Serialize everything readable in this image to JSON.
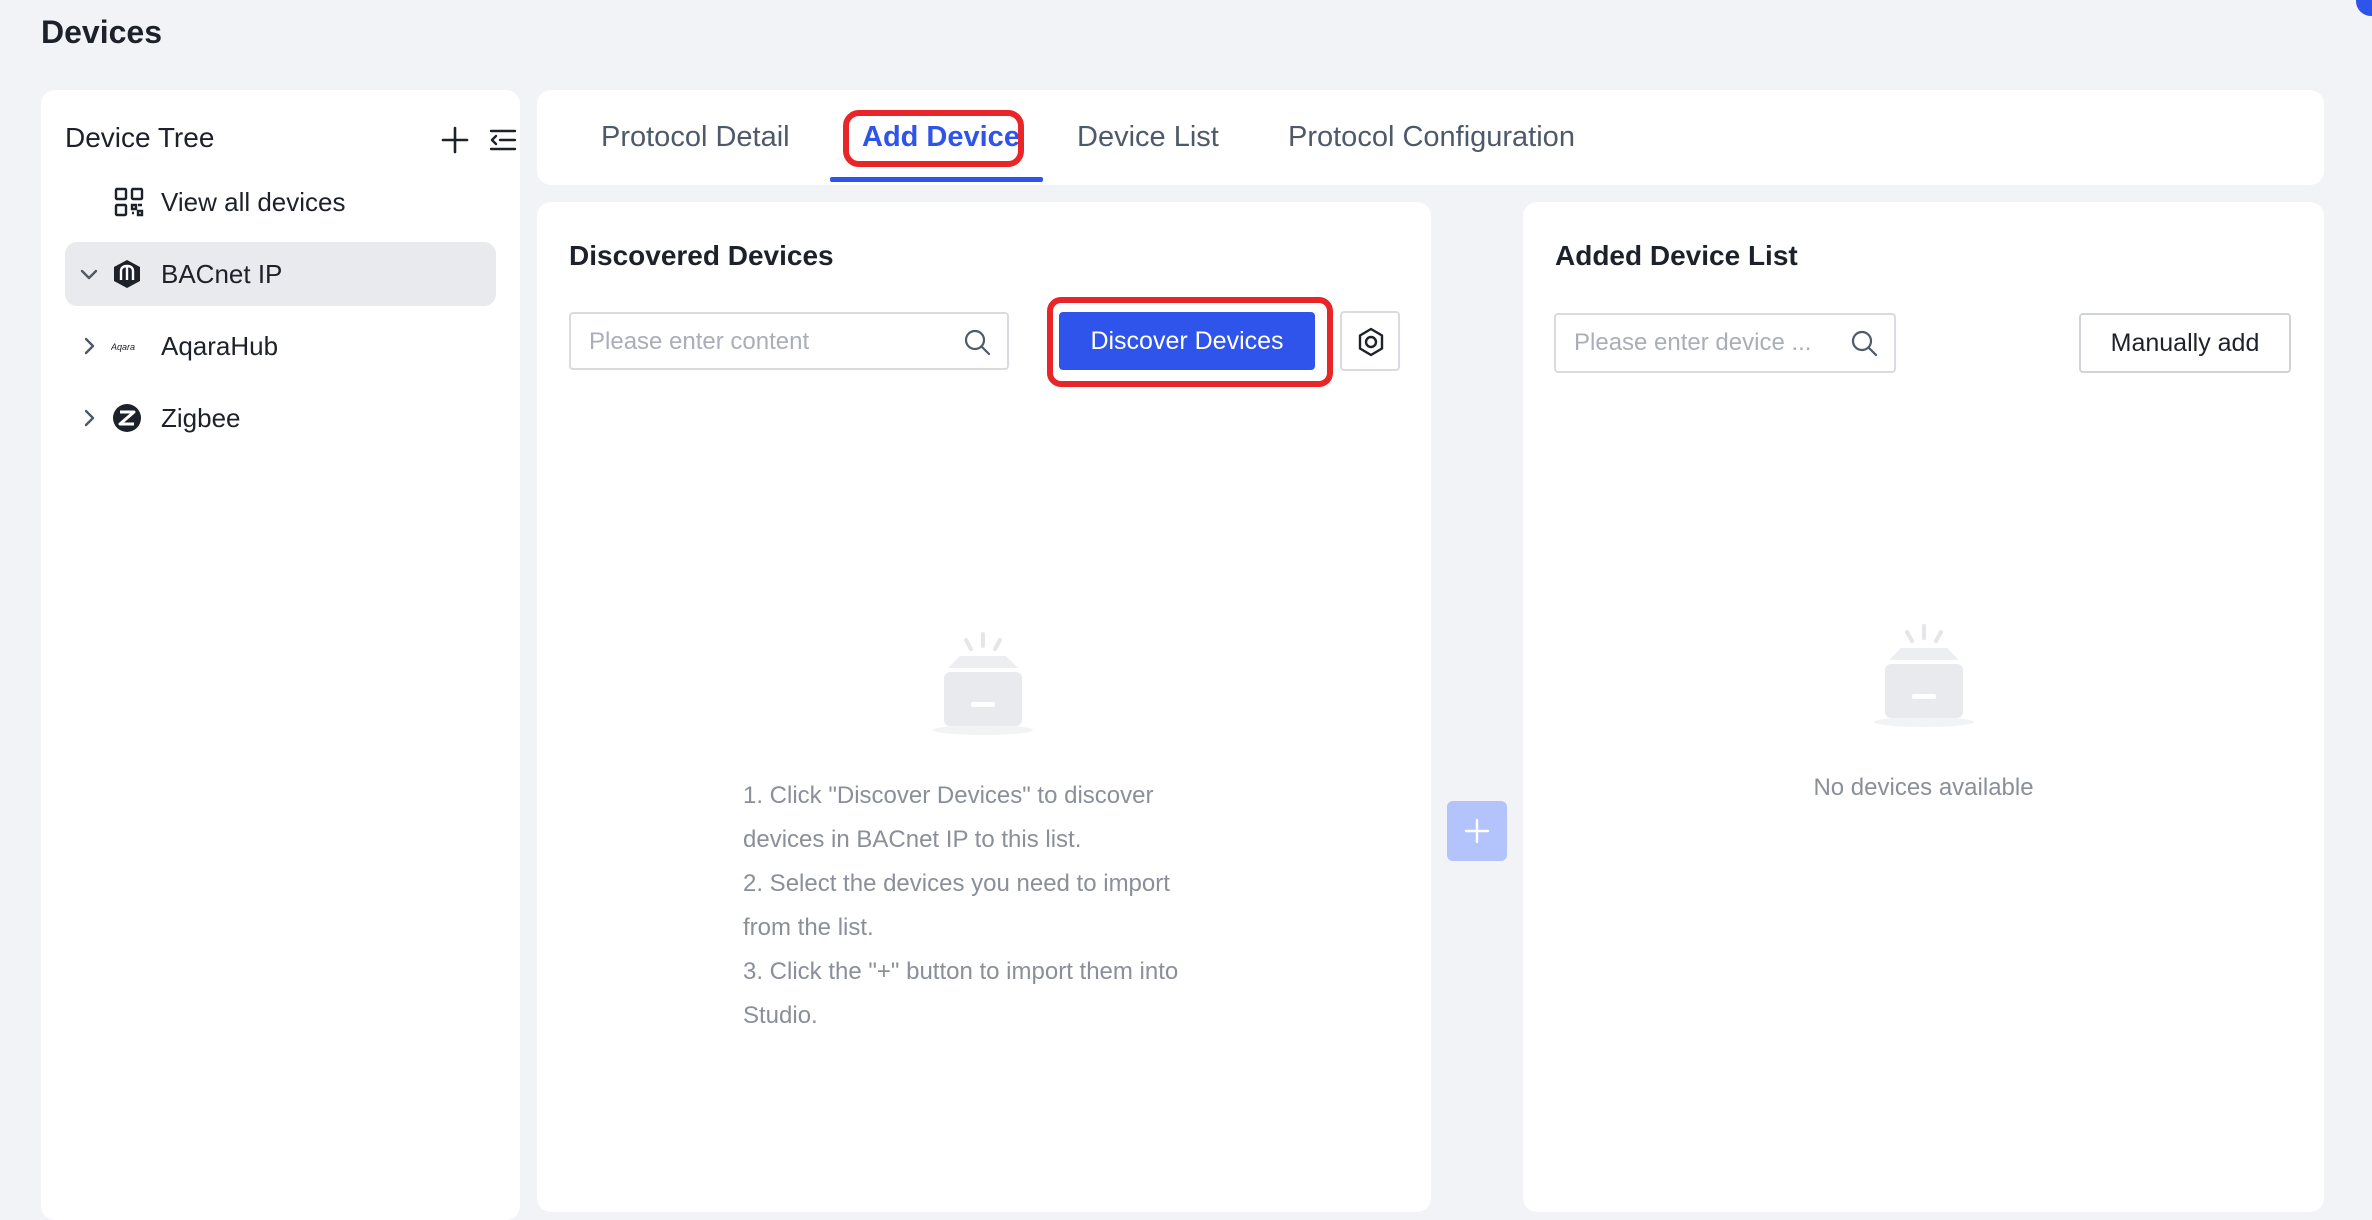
{
  "page": {
    "title": "Devices"
  },
  "sidebar": {
    "title": "Device Tree",
    "view_all": "View all devices",
    "items": [
      {
        "label": "BACnet IP",
        "icon": "bacnet-icon",
        "expanded": true,
        "selected": true
      },
      {
        "label": "AqaraHub",
        "icon": "aqara-logo-icon",
        "expanded": false,
        "selected": false
      },
      {
        "label": "Zigbee",
        "icon": "zigbee-icon",
        "expanded": false,
        "selected": false
      }
    ],
    "aqara_logo_text": "Aqara"
  },
  "tabs": [
    {
      "label": "Protocol Detail",
      "active": false
    },
    {
      "label": "Add Device",
      "active": true
    },
    {
      "label": "Device List",
      "active": false
    },
    {
      "label": "Protocol Configuration",
      "active": false
    }
  ],
  "discovered": {
    "title": "Discovered Devices",
    "search_placeholder": "Please enter content",
    "discover_button": "Discover Devices",
    "instructions": [
      "1. Click \"Discover Devices\" to discover",
      "devices in BACnet IP to this list.",
      "2. Select the devices you need to import",
      "from the list.",
      "3. Click the \"+\" button to import them into",
      "Studio."
    ]
  },
  "added": {
    "title": "Added Device List",
    "search_placeholder": "Please enter device ...",
    "manual_button": "Manually add",
    "empty_text": "No devices available"
  },
  "colors": {
    "accent": "#2f54eb",
    "highlight": "#e8262a",
    "background": "#f2f3f7",
    "transfer_disabled": "#b3c3fb"
  }
}
